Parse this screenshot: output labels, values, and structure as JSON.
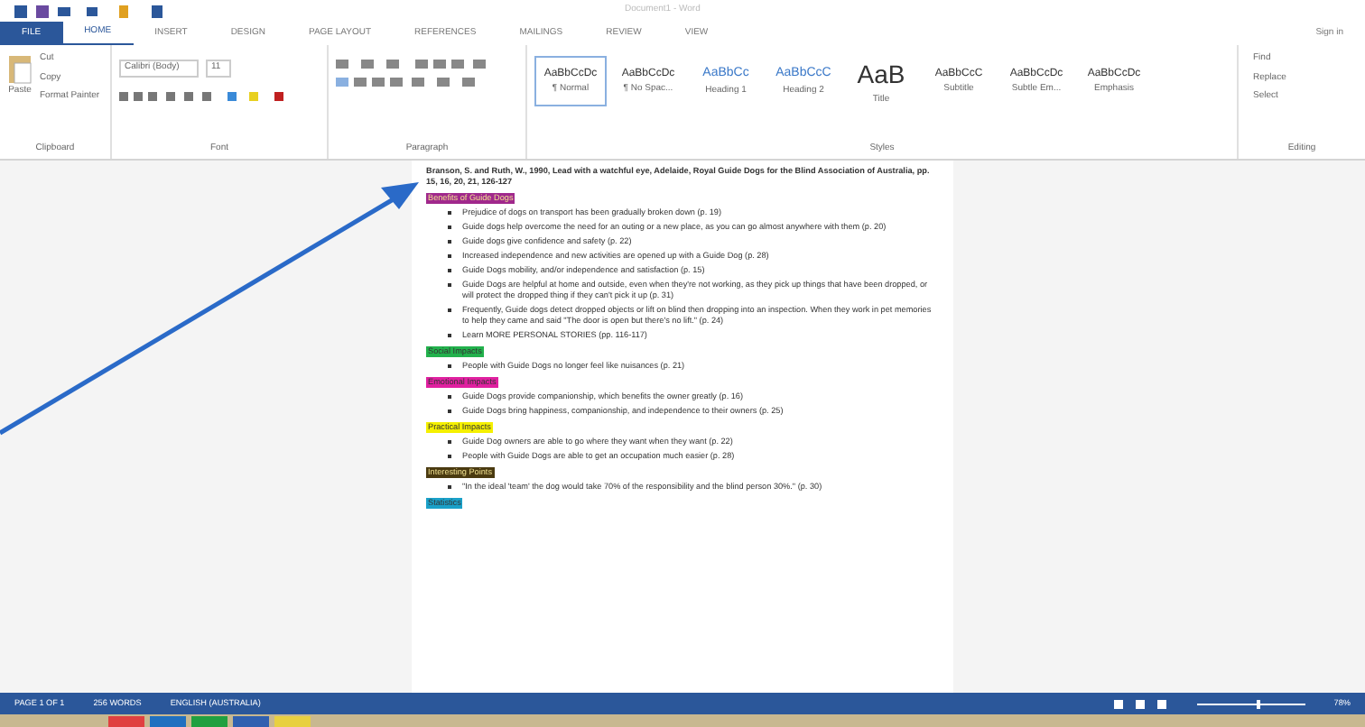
{
  "quick_access": {
    "title": "Document1 - Word"
  },
  "tabs": [
    {
      "label": "FILE",
      "kind": "file",
      "selected": false
    },
    {
      "label": "HOME",
      "kind": "tab",
      "selected": true
    },
    {
      "label": "INSERT",
      "kind": "tab",
      "selected": false
    },
    {
      "label": "DESIGN",
      "kind": "tab",
      "selected": false
    },
    {
      "label": "PAGE LAYOUT",
      "kind": "tab",
      "selected": false
    },
    {
      "label": "REFERENCES",
      "kind": "tab",
      "selected": false
    },
    {
      "label": "MAILINGS",
      "kind": "tab",
      "selected": false
    },
    {
      "label": "REVIEW",
      "kind": "tab",
      "selected": false
    },
    {
      "label": "VIEW",
      "kind": "tab",
      "selected": false
    }
  ],
  "sign_in": "Sign in",
  "clipboard": {
    "paste": "Paste",
    "cut": "Cut",
    "copy": "Copy",
    "format_painter": "Format Painter",
    "label": "Clipboard"
  },
  "font": {
    "name": "Calibri (Body)",
    "size": "11",
    "label": "Font"
  },
  "paragraph": {
    "label": "Paragraph"
  },
  "styles": {
    "label": "Styles",
    "items": [
      {
        "sample": "AaBbCcDc",
        "name": "¶ Normal",
        "selected": true
      },
      {
        "sample": "AaBbCcDc",
        "name": "¶ No Spac...",
        "selected": false
      },
      {
        "sample": "AaBbCc",
        "name": "Heading 1",
        "selected": false
      },
      {
        "sample": "AaBbCcC",
        "name": "Heading 2",
        "selected": false
      },
      {
        "sample": "AaB",
        "name": "Title",
        "selected": false
      },
      {
        "sample": "AaBbCcC",
        "name": "Subtitle",
        "selected": false
      },
      {
        "sample": "AaBbCcDc",
        "name": "Subtle Em...",
        "selected": false
      },
      {
        "sample": "AaBbCcDc",
        "name": "Emphasis",
        "selected": false
      }
    ]
  },
  "editing": {
    "label": "Editing",
    "items": [
      "Find",
      "Replace",
      "Select"
    ]
  },
  "document": {
    "reference": "Branson, S. and Ruth, W., 1990, Lead with a watchful eye, Adelaide, Royal Guide Dogs for the Blind Association of Australia, pp. 15, 16, 20, 21, 126-127",
    "sections": [
      {
        "heading": "Benefits of Guide Dogs",
        "color": "#a0288c",
        "items": [
          "Prejudice of dogs on transport has been gradually broken down (p. 19)",
          "Guide dogs help overcome the need for an outing or a new place, as you can go almost anywhere with them (p. 20)",
          "Guide dogs give confidence and safety (p. 22)",
          "Increased independence and new activities are opened up with a Guide Dog (p. 28)",
          "Guide Dogs mobility, and/or independence and satisfaction (p. 15)",
          "Guide Dogs are helpful at home and outside, even when they're not working, as they pick up things that have been dropped, or will protect the dropped thing if they can't pick it up (p. 31)",
          "Frequently, Guide dogs detect dropped objects or lift on blind then dropping into an inspection. When they work in pet memories to help they came and said \"The door is open but there's no lift.\" (p. 24)",
          "Learn MORE PERSONAL STORIES (pp. 116-117)"
        ]
      },
      {
        "heading": "Social Impacts",
        "color": "#22b14c",
        "items": [
          "People with Guide Dogs no longer feel like nuisances (p. 21)"
        ]
      },
      {
        "heading": "Emotional Impacts",
        "color": "#e020a0",
        "items": [
          "Guide Dogs provide companionship, which benefits the owner greatly (p. 16)",
          "Guide Dogs bring happiness, companionship, and independence to their owners (p. 25)"
        ]
      },
      {
        "heading": "Practical Impacts",
        "color": "#f5f000",
        "items": [
          "Guide Dog owners are able to go where they want when they want (p. 22)",
          "People with Guide Dogs are able to get an occupation much easier (p. 28)"
        ]
      },
      {
        "heading": "Interesting Points",
        "color": "#4a3a10",
        "items": [
          "\"In the ideal 'team' the dog would take 70% of the responsibility and the blind person 30%.\" (p. 30)"
        ]
      },
      {
        "heading": "Statistics",
        "color": "#1aa0c8"
      }
    ]
  },
  "status_bar": {
    "page": "PAGE 1 OF 1",
    "words": "256 WORDS",
    "language": "ENGLISH (AUSTRALIA)",
    "zoom": {
      "level": 0.55
    },
    "zoom_reading": "78%"
  }
}
